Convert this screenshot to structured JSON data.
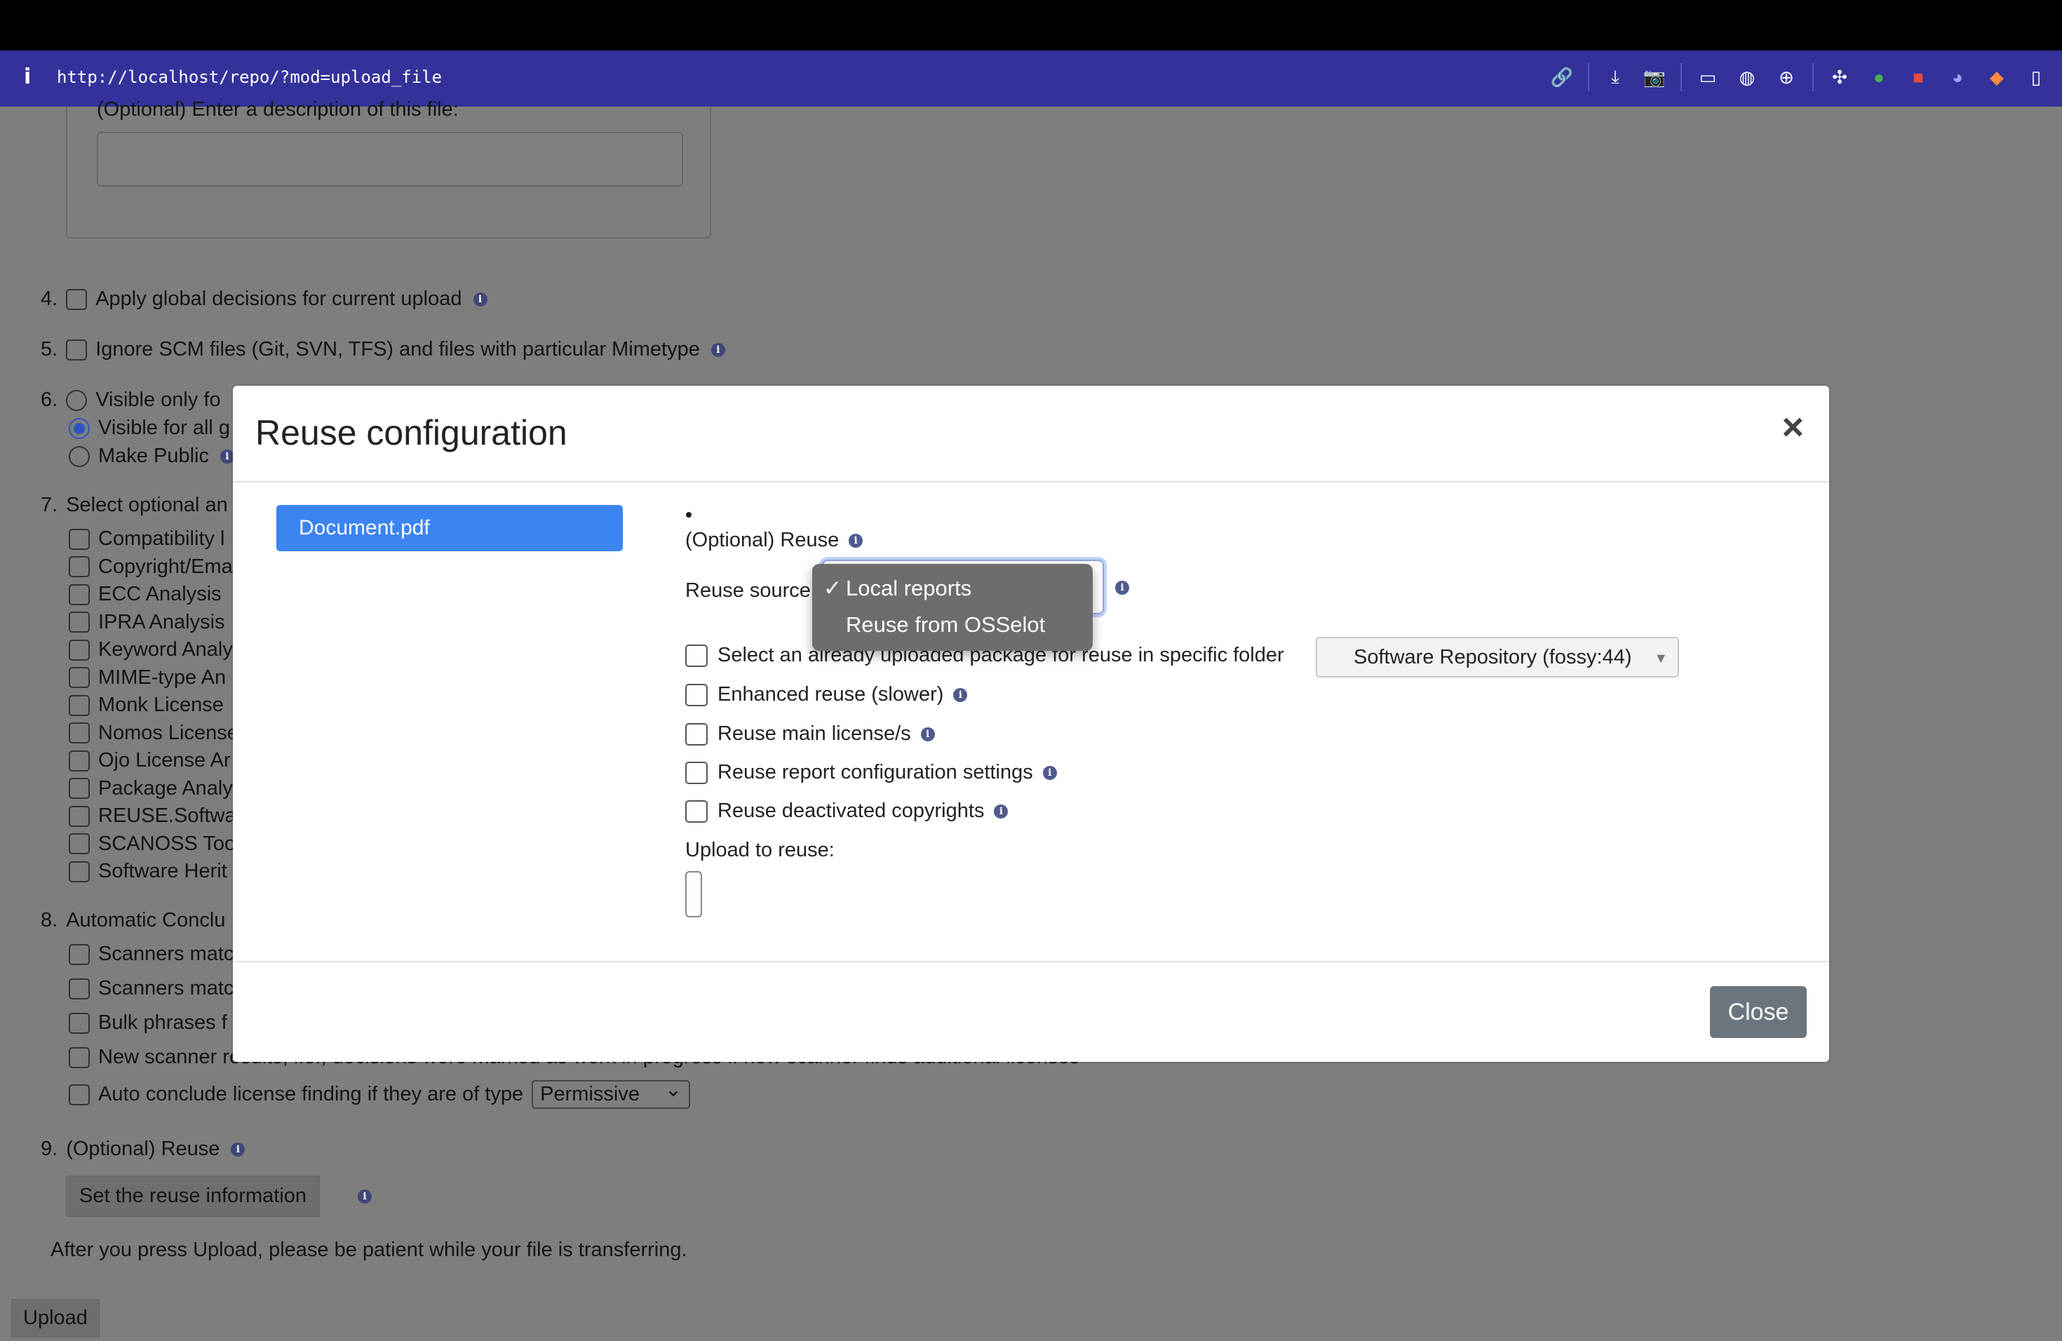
{
  "browser": {
    "info_glyph": "i",
    "url": "http://localhost/repo/?mod=upload_file",
    "toolbar_icons": [
      "link-icon",
      "save-page-icon",
      "camera-icon",
      "terminal-icon",
      "globe-icon",
      "crosshair-icon",
      "extension-icon",
      "green-plus-icon",
      "red-bag-icon",
      "ghost-icon",
      "fox-icon",
      "sidebar-icon"
    ]
  },
  "background": {
    "description_label": "(Optional) Enter a description of this file:",
    "item4": {
      "num": "4.",
      "label": "Apply global decisions for current upload"
    },
    "item5": {
      "num": "5.",
      "label": "Ignore SCM files (Git, SVN, TFS) and files with particular Mimetype"
    },
    "item6": {
      "num": "6.",
      "options": [
        "Visible only fo",
        "Visible for all g",
        "Make Public"
      ]
    },
    "item7": {
      "num": "7.",
      "label": "Select optional an",
      "agents": [
        "Compatibility l",
        "Copyright/Ema",
        "ECC Analysis",
        "IPRA Analysis",
        "Keyword Analy",
        "MIME-type An",
        "Monk License",
        "Nomos License",
        "Ojo License Ar",
        "Package Analy",
        "REUSE.Softwa",
        "SCANOSS Too",
        "Software Herit"
      ]
    },
    "item8": {
      "num": "8.",
      "label": "Automatic Conclu",
      "options": [
        "Scanners matc",
        "Scanners matc",
        "Bulk phrases f",
        "New scanner results, i.e., decisions were marked as work in progress if new scanner finds additional licenses"
      ],
      "auto_conclude": "Auto conclude license finding if they are of type",
      "auto_conclude_value": "Permissive"
    },
    "item9": {
      "num": "9.",
      "label": "(Optional) Reuse",
      "button": "Set the reuse information"
    },
    "notice": "After you press Upload, please be patient while your file is transferring.",
    "upload_button": "Upload"
  },
  "modal": {
    "title": "Reuse configuration",
    "close_x": "×",
    "file_item": "Document.pdf",
    "reuse_heading": "(Optional) Reuse",
    "reuse_source_label": "Reuse source",
    "reuse_source_options": [
      {
        "label": "Local reports",
        "selected": true,
        "check": "✓"
      },
      {
        "label": "Reuse from OSSelot",
        "selected": false,
        "check": ""
      }
    ],
    "select_package_label": "Select an already uploaded package for reuse in specific folder",
    "folder_select_value": "Software Repository (fossy:44)",
    "enhanced_reuse": "Enhanced reuse (slower)",
    "reuse_main_license": "Reuse main license/s",
    "reuse_report_config": "Reuse report configuration settings",
    "reuse_deactivated_copyrights": "Reuse deactivated copyrights",
    "upload_to_reuse": "Upload to reuse:",
    "close_button": "Close",
    "info_glyph": "i"
  },
  "colors": {
    "url_bar": "#34329a",
    "file_item_bg": "#3c84f0",
    "close_button_bg": "#6c757d",
    "overlay": "#7e7e7e"
  }
}
